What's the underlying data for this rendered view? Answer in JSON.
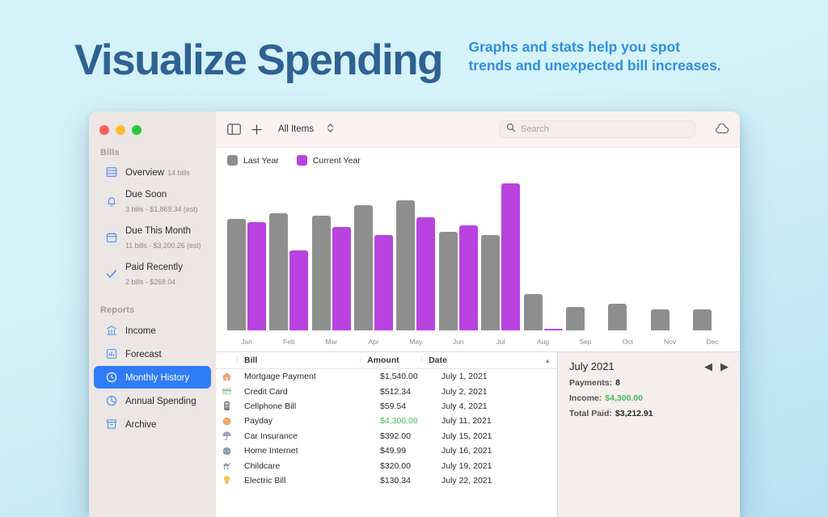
{
  "marketing": {
    "headline": "Visualize Spending",
    "subhead_line1": "Graphs and stats help you spot",
    "subhead_line2": "trends and unexpected bill increases.",
    "headline_color": "#2f6193",
    "subhead_color": "#2e8fe0",
    "background_color": "#d3f2fa"
  },
  "window": {
    "traffic_lights": [
      "close",
      "minimize",
      "zoom"
    ]
  },
  "sidebar": {
    "groups": [
      {
        "title": "Bills",
        "items": [
          {
            "icon": "list-icon",
            "label": "Overview",
            "detail": "14 bills"
          },
          {
            "icon": "bell-icon",
            "label": "Due Soon",
            "detail": "3 bills - $1,869.34 (est)"
          },
          {
            "icon": "calendar-icon",
            "label": "Due This Month",
            "detail": "11 bills - $3,200.26 (est)"
          },
          {
            "icon": "check-icon",
            "label": "Paid Recently",
            "detail": "2 bills - $268.04"
          }
        ]
      },
      {
        "title": "Reports",
        "items": [
          {
            "icon": "bank-icon",
            "label": "Income",
            "detail": ""
          },
          {
            "icon": "barchart-icon",
            "label": "Forecast",
            "detail": ""
          },
          {
            "icon": "clock-icon",
            "label": "Monthly History",
            "detail": "",
            "selected": true
          },
          {
            "icon": "piechart-icon",
            "label": "Annual Spending",
            "detail": ""
          },
          {
            "icon": "archive-icon",
            "label": "Archive",
            "detail": ""
          }
        ]
      }
    ],
    "selected_color": "#2f7cf6"
  },
  "toolbar": {
    "sidebar_toggle": "sidebar-toggle-icon",
    "add_label": "+",
    "filter_value": "All Items",
    "search_placeholder": "Search",
    "search_value": "",
    "cloud_icon": "cloud-icon"
  },
  "chart_data": {
    "type": "bar",
    "title": "Monthly History",
    "categories": [
      "Jan",
      "Feb",
      "Mar",
      "Apr",
      "May",
      "Jun",
      "Jul",
      "Aug",
      "Sep",
      "Oct",
      "Nov",
      "Dec"
    ],
    "series": [
      {
        "name": "Last Year",
        "color": "#8e8e8e",
        "values": [
          3350,
          3500,
          3450,
          3750,
          3900,
          2950,
          2850,
          1100,
          700,
          800,
          620,
          640
        ]
      },
      {
        "name": "Current Year",
        "color": "#b942e0",
        "values": [
          3250,
          2400,
          3100,
          2850,
          3400,
          3150,
          4400,
          60,
          0,
          0,
          0,
          0
        ]
      }
    ],
    "ylim": [
      0,
      4600
    ],
    "ylabel": "",
    "xlabel": "",
    "grid": false,
    "legend_position": "top-left",
    "legend": [
      "Last Year",
      "Current Year"
    ]
  },
  "table": {
    "columns": [
      "Bill",
      "Amount",
      "Date"
    ],
    "sort_indicator": "ascending",
    "rows": [
      {
        "icon": "house-icon",
        "bill": "Mortgage Payment",
        "amount": "$1,540.00",
        "date": "July 1, 2021",
        "income": false
      },
      {
        "icon": "creditcard-icon",
        "bill": "Credit Card",
        "amount": "$512.34",
        "date": "July 2, 2021",
        "income": false
      },
      {
        "icon": "phone-icon",
        "bill": "Cellphone Bill",
        "amount": "$59.54",
        "date": "July 4, 2021",
        "income": false
      },
      {
        "icon": "coin-icon",
        "bill": "Payday",
        "amount": "$4,300.00",
        "date": "July 11, 2021",
        "income": true
      },
      {
        "icon": "umbrella-icon",
        "bill": "Car Insurance",
        "amount": "$392.00",
        "date": "July 15, 2021",
        "income": false
      },
      {
        "icon": "globe-icon",
        "bill": "Home Internet",
        "amount": "$49.99",
        "date": "July 16, 2021",
        "income": false
      },
      {
        "icon": "stroller-icon",
        "bill": "Childcare",
        "amount": "$320.00",
        "date": "July 19, 2021",
        "income": false
      },
      {
        "icon": "bulb-icon",
        "bill": "Electric Bill",
        "amount": "$130.34",
        "date": "July 22, 2021",
        "income": false
      }
    ]
  },
  "detail": {
    "title": "July 2021",
    "prev_label": "◀",
    "next_label": "▶",
    "stats": [
      {
        "label": "Payments:",
        "value": "8",
        "income": false
      },
      {
        "label": "Income:",
        "value": "$4,300.00",
        "income": true
      },
      {
        "label": "Total Paid:",
        "value": "$3,212.91",
        "income": false
      }
    ]
  }
}
